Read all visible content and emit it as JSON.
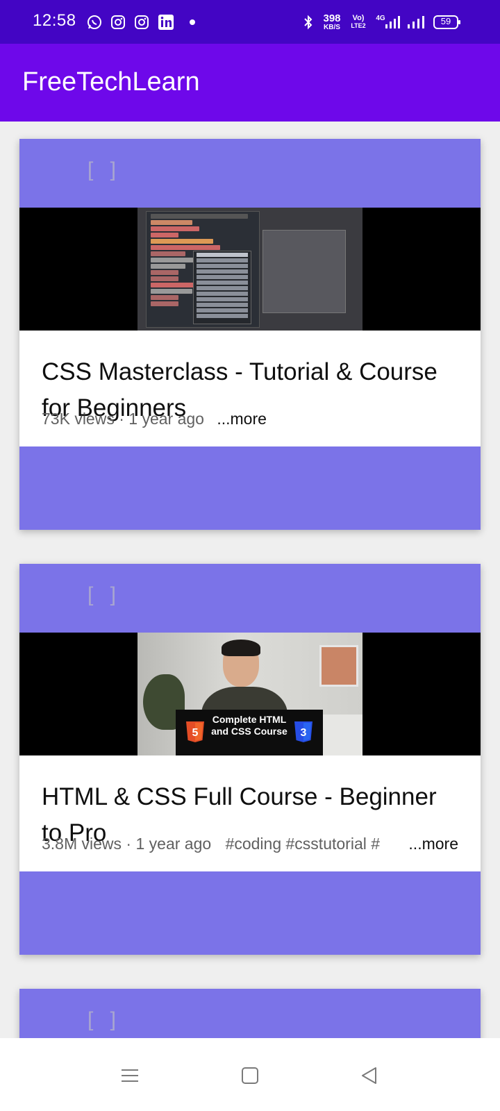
{
  "status_bar": {
    "time": "12:58",
    "net_speed_value": "398",
    "net_speed_unit": "KB/S",
    "volte_top": "Vo)",
    "volte_bottom": "LTE2",
    "network_type": "4G",
    "battery": "59",
    "background": "#4305c4"
  },
  "app_bar": {
    "title": "FreeTechLearn",
    "background": "#6e08ea"
  },
  "videos": [
    {
      "title": "CSS Masterclass - Tutorial & Course for Beginners",
      "meta": "73K views · 1 year ago",
      "tags": "",
      "more_label": "...more",
      "placeholder": "[ ]",
      "thumbnail": "code-editor-screenshot"
    },
    {
      "title": "HTML & CSS Full Course - Beginner to Pro",
      "meta": "3.8M views · 1 year ago",
      "tags": "#coding #csstutorial #",
      "more_label": "...more",
      "placeholder": "[ ]",
      "thumbnail": "presenter-video",
      "thumbnail_caption": "Complete HTML and CSS Course"
    },
    {
      "placeholder": "[ ]"
    }
  ],
  "colors": {
    "card_band": "#7b73e8",
    "html5_orange": "#e44d26",
    "css3_blue": "#264de4"
  },
  "nav_bar": {
    "icons": [
      "menu-icon",
      "home-square-icon",
      "back-triangle-icon"
    ]
  }
}
